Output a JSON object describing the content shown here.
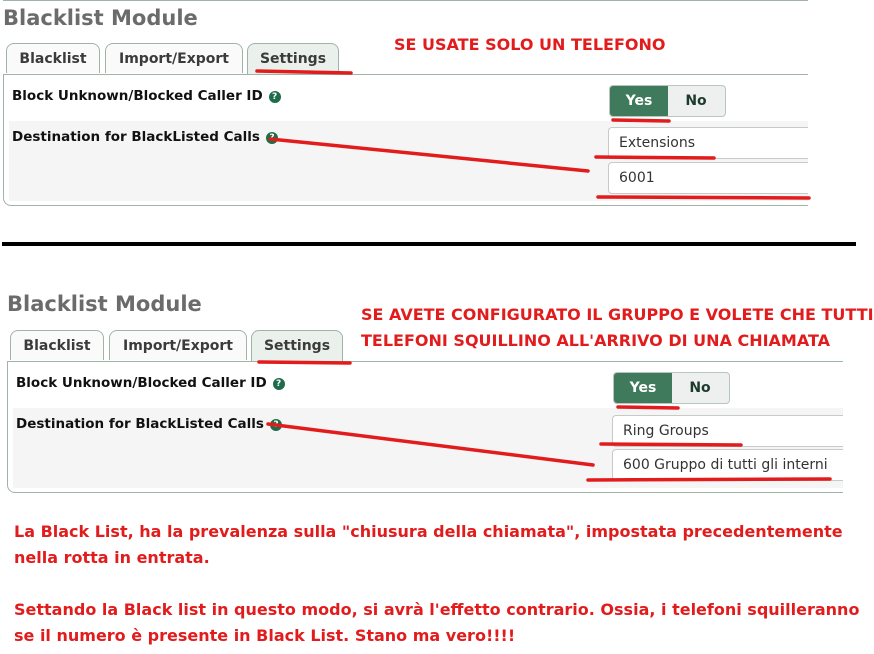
{
  "top": {
    "title": "Blacklist Module",
    "tabs": [
      "Blacklist",
      "Import/Export",
      "Settings"
    ],
    "block_label": "Block Unknown/Blocked Caller ID",
    "toggle_yes": "Yes",
    "toggle_no": "No",
    "dest_label": "Destination for BlackListed Calls",
    "dest_type": "Extensions",
    "dest_value": "6001",
    "note": "SE USATE SOLO UN TELEFONO"
  },
  "bottom": {
    "title": "Blacklist Module",
    "tabs": [
      "Blacklist",
      "Import/Export",
      "Settings"
    ],
    "block_label": "Block Unknown/Blocked Caller ID",
    "toggle_yes": "Yes",
    "toggle_no": "No",
    "dest_label": "Destination for BlackListed Calls",
    "dest_type": "Ring Groups",
    "dest_value": "600 Gruppo di tutti gli interni",
    "note_line1": "SE AVETE CONFIGURATO IL GRUPPO E VOLETE CHE TUTTI I",
    "note_line2": "TELEFONI SQUILLINO ALL'ARRIVO DI UNA CHIAMATA"
  },
  "footer": {
    "para1": "La Black List, ha la prevalenza sulla \"chiusura della chiamata\", impostata precedentemente nella rotta in entrata.",
    "para2": "Settando la Black list in questo modo, si avrà l'effetto contrario. Ossia, i telefoni squilleranno se il numero è presente in Black List. Stano ma vero!!!!"
  },
  "colors": {
    "annotation": "#e21c1c",
    "toggle_active": "#3f7a5c",
    "help_icon": "#1e6c4a"
  },
  "icons": {
    "help": "question-circle-icon"
  }
}
